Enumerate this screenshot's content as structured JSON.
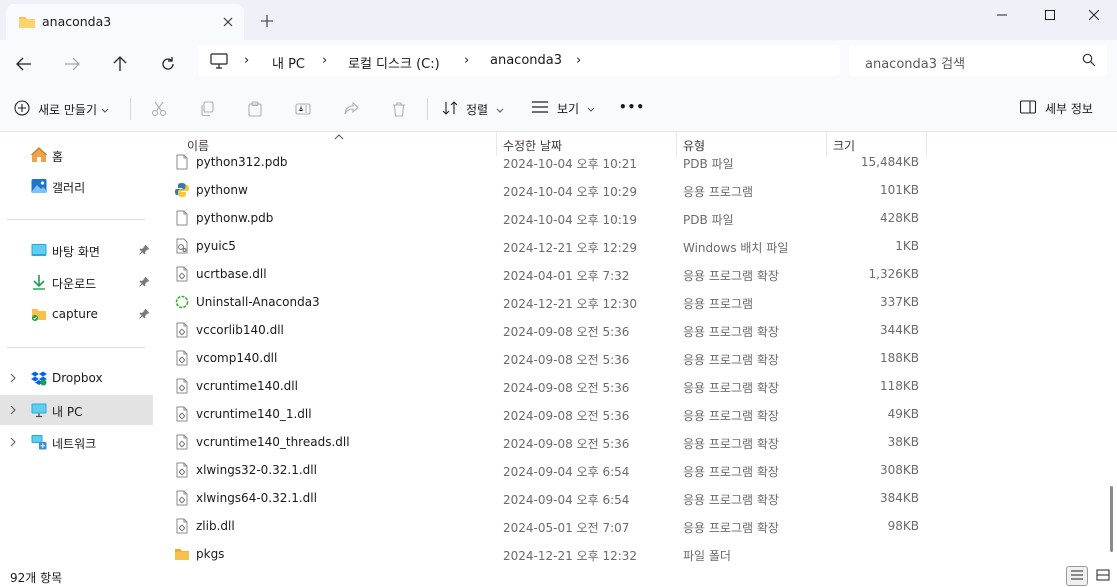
{
  "tab": {
    "title": "anaconda3"
  },
  "address": {
    "crumbs": [
      "내 PC",
      "로컬 디스크 (C:)",
      "anaconda3"
    ]
  },
  "search": {
    "placeholder": "anaconda3 검색"
  },
  "toolbar": {
    "new_label": "새로 만들기",
    "sort_label": "정렬",
    "view_label": "보기",
    "more_label": "•••",
    "details_label": "세부 정보",
    "icons": [
      "cut-icon",
      "copy-icon",
      "paste-icon",
      "rename-icon",
      "share-icon",
      "delete-icon"
    ]
  },
  "sidebar": {
    "items": [
      {
        "label": "홈",
        "icon": "home-icon"
      },
      {
        "label": "갤러리",
        "icon": "gallery-icon"
      },
      {
        "label": "바탕 화면",
        "icon": "desktop-icon",
        "pinned": true
      },
      {
        "label": "다운로드",
        "icon": "download-icon",
        "pinned": true
      },
      {
        "label": "capture",
        "icon": "folder-icon",
        "pinned": true
      },
      {
        "label": "Dropbox",
        "icon": "dropbox-icon",
        "expandable": true
      },
      {
        "label": "내 PC",
        "icon": "pc-icon",
        "expandable": true,
        "selected": true
      },
      {
        "label": "네트워크",
        "icon": "network-icon",
        "expandable": true
      }
    ]
  },
  "columns": {
    "name": "이름",
    "date": "수정한 날짜",
    "type": "유형",
    "size": "크기"
  },
  "files": [
    {
      "name": "python312.pdb",
      "date": "2024-10-04 오후 10:21",
      "type": "PDB 파일",
      "size": "15,484KB",
      "icon": "file-icon"
    },
    {
      "name": "pythonw",
      "date": "2024-10-04 오후 10:29",
      "type": "응용 프로그램",
      "size": "101KB",
      "icon": "python-icon"
    },
    {
      "name": "pythonw.pdb",
      "date": "2024-10-04 오후 10:19",
      "type": "PDB 파일",
      "size": "428KB",
      "icon": "file-icon"
    },
    {
      "name": "pyuic5",
      "date": "2024-12-21 오후 12:29",
      "type": "Windows 배치 파일",
      "size": "1KB",
      "icon": "batch-icon"
    },
    {
      "name": "ucrtbase.dll",
      "date": "2024-04-01 오후 7:32",
      "type": "응용 프로그램 확장",
      "size": "1,326KB",
      "icon": "dll-icon"
    },
    {
      "name": "Uninstall-Anaconda3",
      "date": "2024-12-21 오후 12:30",
      "type": "응용 프로그램",
      "size": "337KB",
      "icon": "anaconda-icon"
    },
    {
      "name": "vccorlib140.dll",
      "date": "2024-09-08 오전 5:36",
      "type": "응용 프로그램 확장",
      "size": "344KB",
      "icon": "dll-icon"
    },
    {
      "name": "vcomp140.dll",
      "date": "2024-09-08 오전 5:36",
      "type": "응용 프로그램 확장",
      "size": "188KB",
      "icon": "dll-icon"
    },
    {
      "name": "vcruntime140.dll",
      "date": "2024-09-08 오전 5:36",
      "type": "응용 프로그램 확장",
      "size": "118KB",
      "icon": "dll-icon"
    },
    {
      "name": "vcruntime140_1.dll",
      "date": "2024-09-08 오전 5:36",
      "type": "응용 프로그램 확장",
      "size": "49KB",
      "icon": "dll-icon"
    },
    {
      "name": "vcruntime140_threads.dll",
      "date": "2024-09-08 오전 5:36",
      "type": "응용 프로그램 확장",
      "size": "38KB",
      "icon": "dll-icon"
    },
    {
      "name": "xlwings32-0.32.1.dll",
      "date": "2024-09-04 오후 6:54",
      "type": "응용 프로그램 확장",
      "size": "308KB",
      "icon": "dll-icon"
    },
    {
      "name": "xlwings64-0.32.1.dll",
      "date": "2024-09-04 오후 6:54",
      "type": "응용 프로그램 확장",
      "size": "384KB",
      "icon": "dll-icon"
    },
    {
      "name": "zlib.dll",
      "date": "2024-05-01 오전 7:07",
      "type": "응용 프로그램 확장",
      "size": "98KB",
      "icon": "dll-icon"
    },
    {
      "name": "pkgs",
      "date": "2024-12-21 오후 12:32",
      "type": "파일 폴더",
      "size": "",
      "icon": "folder-icon"
    }
  ],
  "status": {
    "count": "92개 항목"
  },
  "colors": {
    "accent": "#0067c0",
    "folder": "#f8c14d",
    "selected_bg": "#e3e3e3"
  }
}
